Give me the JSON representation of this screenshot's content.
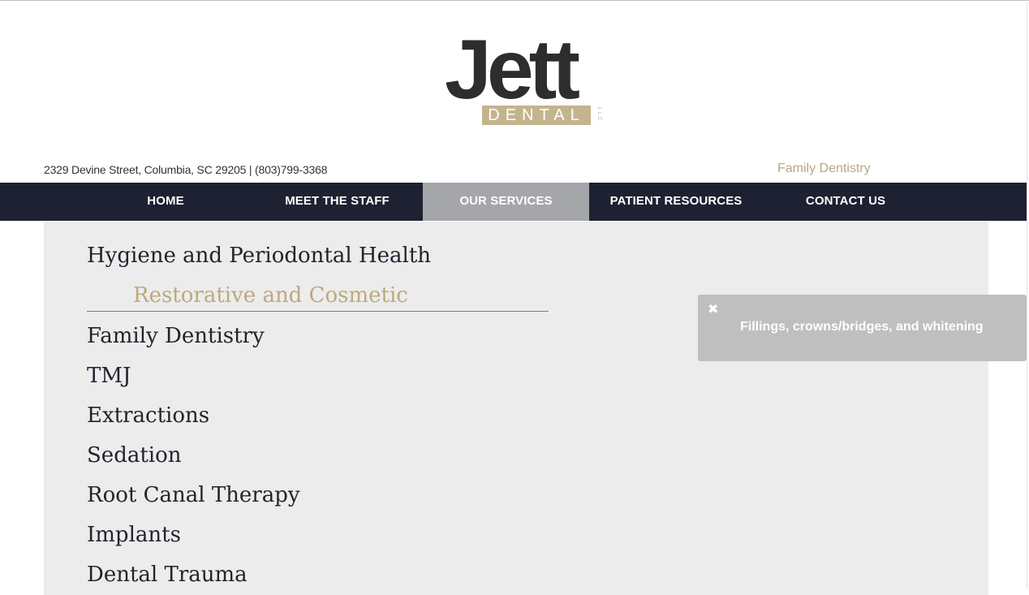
{
  "logo": {
    "name": "Jett",
    "subtitle": "DENTAL",
    "suffix": "LLC"
  },
  "header": {
    "address": "2329 Devine Street, Columbia, SC 29205 | (803)799-3368",
    "tagline": "Family Dentistry"
  },
  "nav": [
    {
      "label": "HOME",
      "active": false
    },
    {
      "label": "MEET THE STAFF",
      "active": false
    },
    {
      "label": "OUR SERVICES",
      "active": true
    },
    {
      "label": "PATIENT RESOURCES",
      "active": false
    },
    {
      "label": "CONTACT US",
      "active": false
    }
  ],
  "services": [
    {
      "label": "Hygiene and Periodontal Health",
      "active": false
    },
    {
      "label": "Restorative and Cosmetic",
      "active": true
    },
    {
      "label": "Family Dentistry",
      "active": false
    },
    {
      "label": "TMJ",
      "active": false
    },
    {
      "label": "Extractions",
      "active": false
    },
    {
      "label": "Sedation",
      "active": false
    },
    {
      "label": "Root Canal Therapy",
      "active": false
    },
    {
      "label": "Implants",
      "active": false
    },
    {
      "label": "Dental Trauma",
      "active": false
    }
  ],
  "tooltip": {
    "close_icon": "close-icon",
    "close_glyph": "✖",
    "text": "Fillings, crowns/bridges, and whitening"
  },
  "colors": {
    "nav_bg": "#1d2131",
    "nav_active": "#a5a6aa",
    "accent_gold": "#bca97c",
    "panel_bg": "#ececec",
    "tooltip_bg": "#bfbfbf"
  }
}
